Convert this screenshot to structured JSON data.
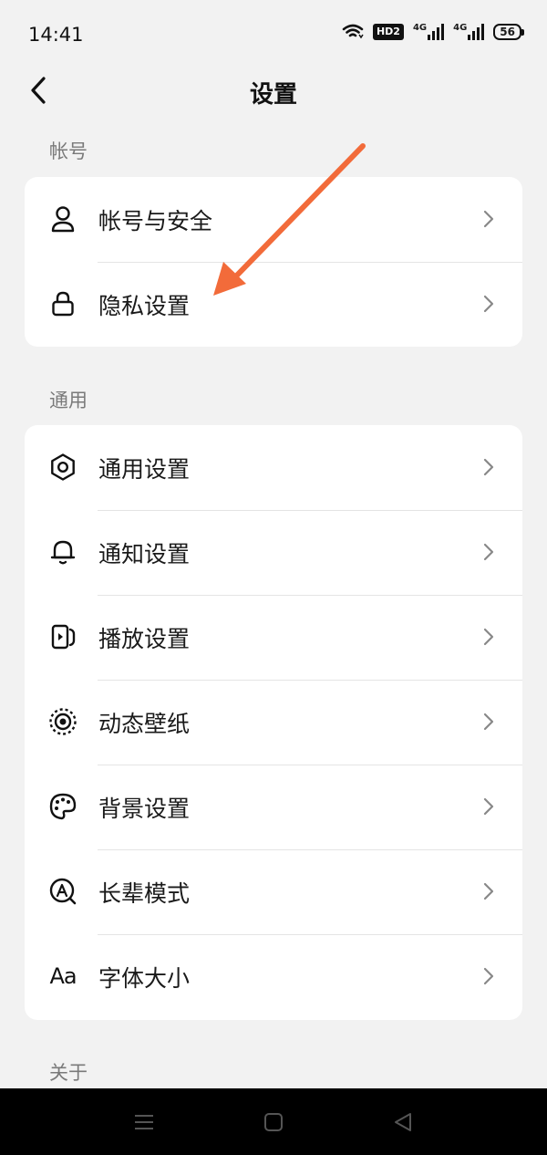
{
  "status_bar": {
    "time": "14:41",
    "hd_label": "HD2",
    "net1_label": "4G",
    "net2_label": "4G",
    "battery": "56"
  },
  "header": {
    "title": "设置"
  },
  "sections": [
    {
      "label": "帐号",
      "items": [
        {
          "label": "帐号与安全",
          "icon": "person-icon"
        },
        {
          "label": "隐私设置",
          "icon": "lock-icon"
        }
      ]
    },
    {
      "label": "通用",
      "items": [
        {
          "label": "通用设置",
          "icon": "gear-icon"
        },
        {
          "label": "通知设置",
          "icon": "bell-icon"
        },
        {
          "label": "播放设置",
          "icon": "play-card-icon"
        },
        {
          "label": "动态壁纸",
          "icon": "dynamic-wallpaper-icon"
        },
        {
          "label": "背景设置",
          "icon": "palette-icon"
        },
        {
          "label": "长辈模式",
          "icon": "elder-mode-icon"
        },
        {
          "label": "字体大小",
          "icon": "font-size-icon",
          "icon_text": "Aa"
        }
      ]
    },
    {
      "label": "关于",
      "items": []
    }
  ],
  "annotation": {
    "color": "#f26b3a"
  },
  "colors": {
    "background": "#f2f2f2",
    "card": "#ffffff",
    "section_label": "#7a7a7a"
  }
}
